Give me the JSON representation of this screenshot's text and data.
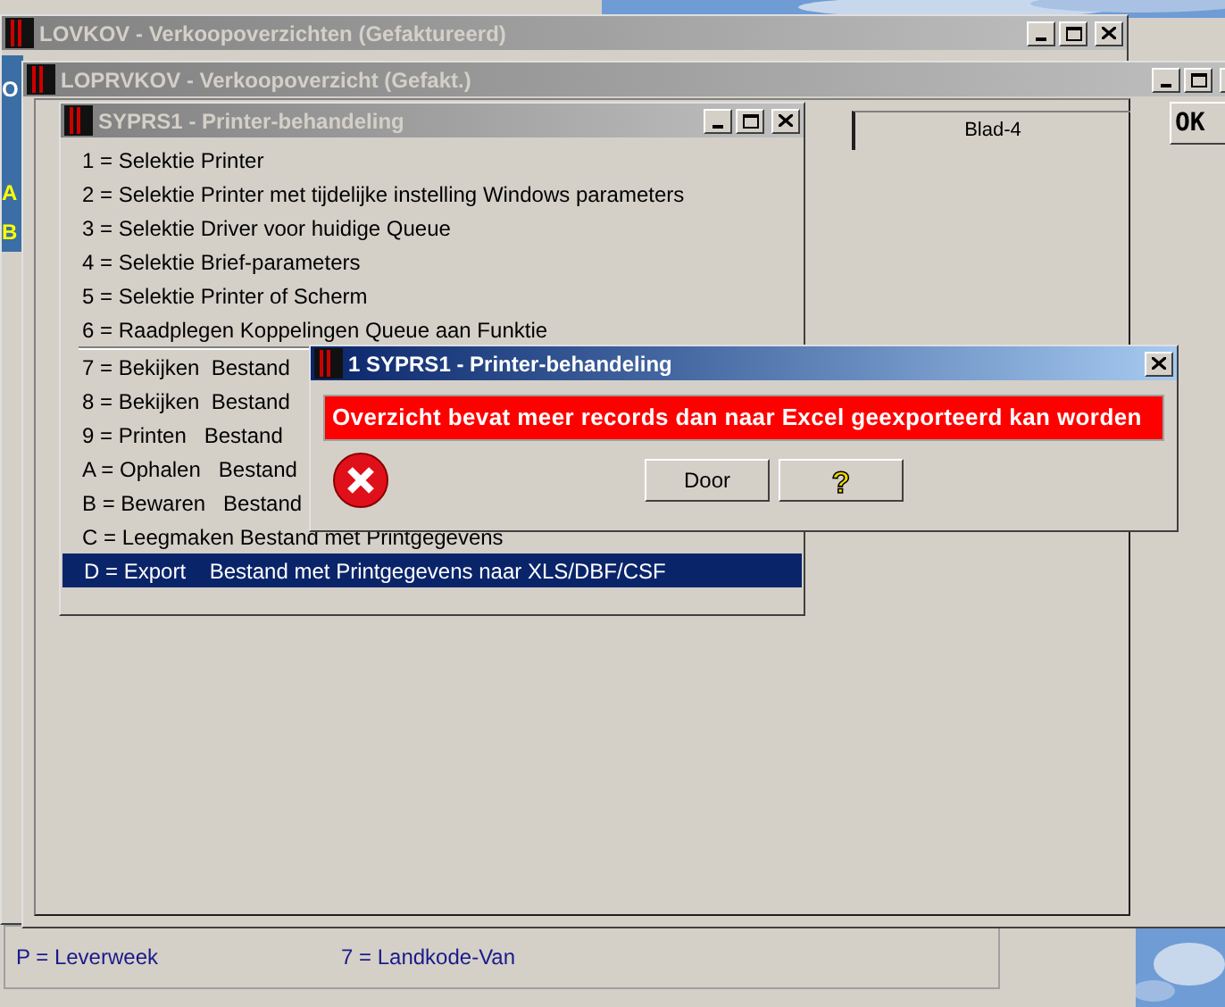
{
  "desktop_fragments": [
    "O",
    "A",
    "B"
  ],
  "back_window": {
    "title": "LOVKOV - Verkoopoverzichten (Gefaktureerd)",
    "active": false,
    "legend": [
      "P = Leverweek",
      "7 = Landkode-Van"
    ]
  },
  "main_window": {
    "title": "LOPRVKOV - Verkoopoverzicht (Gefakt.)",
    "active": false,
    "tab": "Blad-4",
    "ok_button": "OK"
  },
  "printer_window": {
    "title": "SYPRS1 - Printer-behandeling",
    "active": false,
    "items": [
      {
        "label": "1 = Selektie Printer",
        "selected": false,
        "separator_above": false
      },
      {
        "label": "2 = Selektie Printer met tijdelijke instelling Windows parameters",
        "selected": false,
        "separator_above": false
      },
      {
        "label": "3 = Selektie Driver voor huidige Queue",
        "selected": false,
        "separator_above": false
      },
      {
        "label": "4 = Selektie Brief-parameters",
        "selected": false,
        "separator_above": false
      },
      {
        "label": "5 = Selektie Printer of Scherm",
        "selected": false,
        "separator_above": false
      },
      {
        "label": "6 = Raadplegen Koppelingen Queue aan Funktie",
        "selected": false,
        "separator_above": false
      },
      {
        "label": "7 = Bekijken  Bestand",
        "selected": false,
        "separator_above": true
      },
      {
        "label": "8 = Bekijken  Bestand",
        "selected": false,
        "separator_above": false
      },
      {
        "label": "9 = Printen   Bestand",
        "selected": false,
        "separator_above": false
      },
      {
        "label": "A = Ophalen   Bestand",
        "selected": false,
        "separator_above": false
      },
      {
        "label": "B = Bewaren   Bestand",
        "selected": false,
        "separator_above": false
      },
      {
        "label": "C = Leegmaken Bestand met Printgegevens",
        "selected": false,
        "separator_above": false
      },
      {
        "label": "D = Export    Bestand met Printgegevens naar XLS/DBF/CSF",
        "selected": true,
        "separator_above": false
      }
    ]
  },
  "dialog": {
    "title": "1 SYPRS1 - Printer-behandeling",
    "active": true,
    "message": "Overzicht bevat meer records dan naar Excel geexporteerd kan worden",
    "buttons": [
      "Door",
      "?"
    ]
  }
}
